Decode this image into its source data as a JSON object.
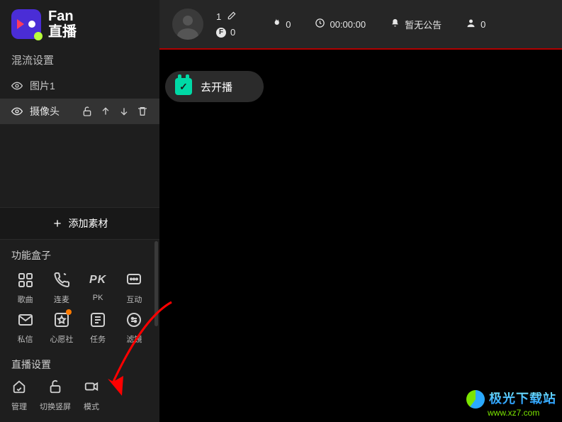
{
  "app": {
    "name_en": "Fan",
    "name_cn": "直播"
  },
  "sidebar": {
    "mix_title": "混流设置",
    "sources": [
      {
        "label": "图片1",
        "selected": false
      },
      {
        "label": "摄像头",
        "selected": true
      }
    ],
    "add_material": "添加素材",
    "func_title": "功能盒子",
    "func_items": [
      {
        "key": "songs",
        "label": "歌曲",
        "icon": "grid-icon"
      },
      {
        "key": "lianmai",
        "label": "连麦",
        "icon": "phone-icon"
      },
      {
        "key": "pk",
        "label": "PK",
        "icon": "pk-text"
      },
      {
        "key": "interact",
        "label": "互动",
        "icon": "chat-icon"
      },
      {
        "key": "sixin",
        "label": "私信",
        "icon": "mail-icon"
      },
      {
        "key": "wish",
        "label": "心愿社",
        "icon": "star-box-icon",
        "badge": true
      },
      {
        "key": "tasks",
        "label": "任务",
        "icon": "list-icon"
      },
      {
        "key": "filter",
        "label": "滤镜",
        "icon": "sliders-icon"
      }
    ],
    "stream_title": "直播设置",
    "stream_items": [
      {
        "key": "manage",
        "label": "管理",
        "icon": "home-icon"
      },
      {
        "key": "portrait",
        "label": "切换竖屏",
        "icon": "lock-open-icon"
      },
      {
        "key": "mode",
        "label": "模式",
        "icon": "camera-icon"
      }
    ]
  },
  "header": {
    "user_num": "1",
    "coin_label": "F",
    "coins": "0",
    "fire": "0",
    "timer": "00:00:00",
    "announce": "暂无公告",
    "viewers": "0"
  },
  "golive": {
    "label": "去开播"
  },
  "watermark": {
    "cn": "极光下载站",
    "url": "www.xz7.com"
  },
  "colors": {
    "accent": "#00d9a6",
    "arrow": "#ff0000"
  }
}
